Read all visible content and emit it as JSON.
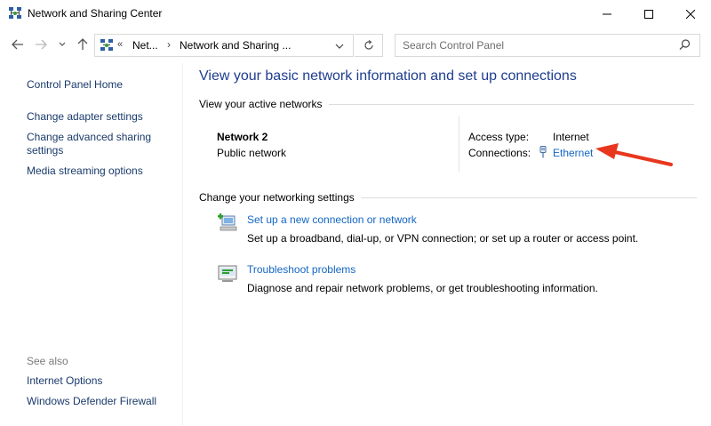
{
  "window": {
    "title": "Network and Sharing Center"
  },
  "address": {
    "overflow": "«",
    "crumbs": [
      "Net...",
      "Network and Sharing ..."
    ],
    "separator": "›",
    "search_placeholder": "Search Control Panel"
  },
  "sidebar": {
    "links": [
      {
        "label": "Control Panel Home"
      },
      {
        "label": "Change adapter settings"
      },
      {
        "label": "Change advanced sharing settings"
      },
      {
        "label": "Media streaming options"
      }
    ],
    "see_also_label": "See also",
    "see_also_links": [
      {
        "label": "Internet Options"
      },
      {
        "label": "Windows Defender Firewall"
      }
    ]
  },
  "main": {
    "heading": "View your basic network information and set up connections",
    "active_networks_header": "View your active networks",
    "network": {
      "name": "Network 2",
      "type": "Public network",
      "access_type_label": "Access type:",
      "access_type_value": "Internet",
      "connections_label": "Connections:",
      "connections_value": "Ethernet"
    },
    "settings_header": "Change your networking settings",
    "tasks": [
      {
        "icon": "new-connection-icon",
        "link": "Set up a new connection or network",
        "description": "Set up a broadband, dial-up, or VPN connection; or set up a router or access point."
      },
      {
        "icon": "troubleshoot-icon",
        "link": "Troubleshoot problems",
        "description": "Diagnose and repair network problems, or get troubleshooting information."
      }
    ]
  },
  "colors": {
    "link": "#1366c4",
    "heading": "#1e3d8f",
    "nav_link": "#1a3a6b",
    "annotation_arrow": "#e8371e"
  }
}
